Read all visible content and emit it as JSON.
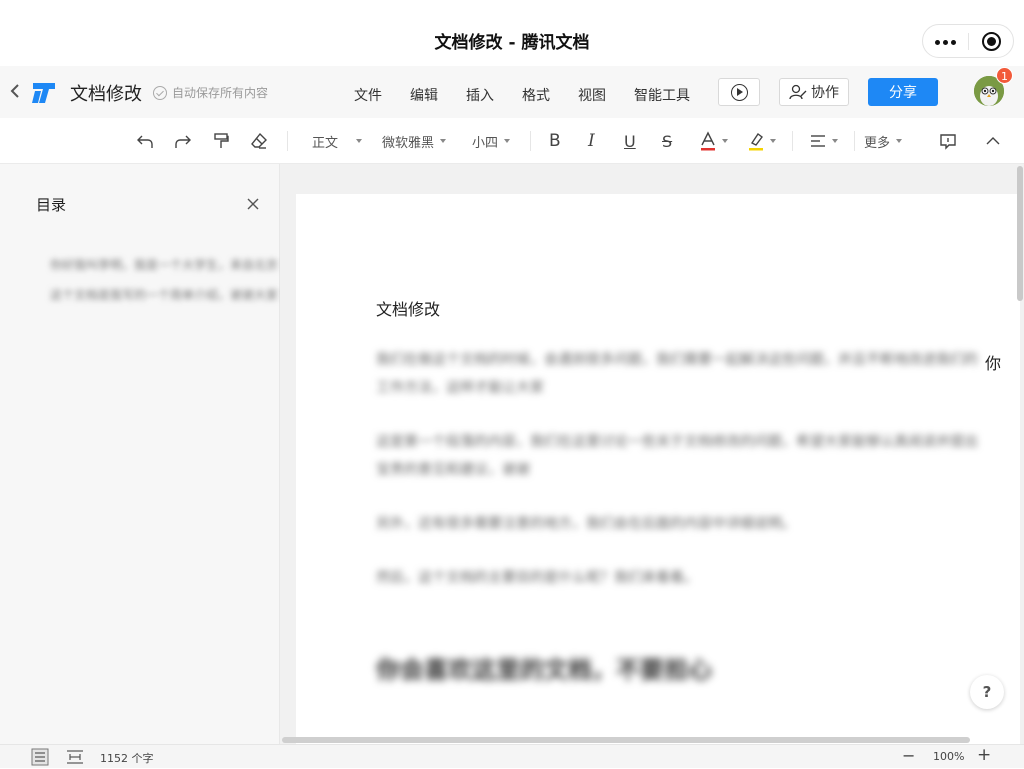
{
  "window": {
    "title": "文档修改 - 腾讯文档"
  },
  "header": {
    "doc_title": "文档修改",
    "autosave_text": "自动保存所有内容",
    "menu": [
      "文件",
      "编辑",
      "插入",
      "格式",
      "视图",
      "智能工具"
    ],
    "collab_label": "协作",
    "share_label": "分享",
    "notification_count": "1",
    "colors": {
      "share_button": "#1e88f5",
      "badge": "#f25a3a"
    }
  },
  "toolbar": {
    "style_select": "正文",
    "font_select": "微软雅黑",
    "size_select": "小四",
    "more_label": "更多",
    "font_color_accent": "#e0332f",
    "highlight_accent": "#f5d300",
    "icons": [
      "undo-icon",
      "redo-icon",
      "format-painter-icon",
      "clear-format-icon",
      "bold-icon",
      "italic-icon",
      "underline-icon",
      "strikethrough-icon",
      "font-color-icon",
      "highlight-icon",
      "align-icon",
      "comment-icon",
      "collapse-icon"
    ]
  },
  "sidebar": {
    "title": "目录",
    "items": [
      "你好我叫李明，我是一个大学生，来自北京",
      "这个文档是我写的一个简单介绍，谢谢大家"
    ]
  },
  "document": {
    "heading": "文档修改",
    "paragraphs": [
      "我们在做这个文档的时候，会遇到很多问题，我们需要一起解决这些问题，并且不断地改进我们的工作方法，这样才能让大家",
      "这是第一个段落的内容，我们在这里讨论一些关于文档修改的问题，希望大家能够认真阅读并提出宝贵的意见和建议，谢谢",
      "另外，还有很多需要注意的地方，我们会在后面的内容中详细说明。",
      "然后，这个文档的主要目的是什么呢？我们来看看。"
    ],
    "tail_char": "你",
    "big_line": "你会喜欢这里的文档，不要担心"
  },
  "status": {
    "word_count": "1152 个字",
    "zoom": "100%"
  }
}
